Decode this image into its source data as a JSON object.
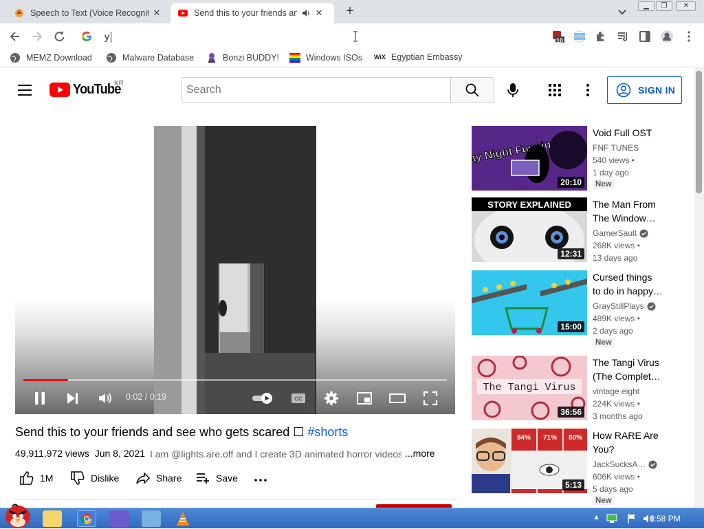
{
  "browser": {
    "tabs": [
      {
        "title": "Speech to Text (Voice Recognition)"
      },
      {
        "title": "Send this to your friends and see who gets scared"
      }
    ],
    "omnibox_text": "y",
    "extensions_badge": "10",
    "bookmarks": [
      "MEMZ Download",
      "Malware Database",
      "Bonzi BUDDY!",
      "Windows ISOs",
      "Egyptian Embassy"
    ]
  },
  "youtube": {
    "logo_text": "YouTube",
    "region": "KR",
    "search_placeholder": "Search",
    "signin_label": "SIGN IN"
  },
  "player": {
    "time": "0:02 / 0:19",
    "progress_fraction": 0.105
  },
  "video": {
    "title": "Send this to your friends and see who gets scared ☐",
    "hashtag": "#shorts",
    "views": "49,911,972 views",
    "date": "Jun 8, 2021",
    "description": "I am @lights.are.off and I create 3D animated horror videos",
    "more_label": "...more",
    "actions": {
      "likes": "1M",
      "dislike": "Dislike",
      "share": "Share",
      "save": "Save"
    }
  },
  "sidebar": [
    {
      "title_1": "Void Full OST",
      "title_2": "",
      "channel": "FNF TUNES",
      "views": "540 views •",
      "ago": "1 day ago",
      "badge": "New",
      "duration": "20:10"
    },
    {
      "title_1": "The Man From",
      "title_2": "The Window…",
      "channel": "GamerSault",
      "views": "268K views •",
      "ago": "13 days ago",
      "badge": "",
      "duration": "12:31"
    },
    {
      "title_1": "Cursed things",
      "title_2": "to do in happy…",
      "channel": "GrayStillPlays",
      "views": "489K views •",
      "ago": "2 days ago",
      "badge": "New",
      "duration": "15:00"
    },
    {
      "title_1": "The Tangi Virus",
      "title_2": "(The Complet…",
      "channel": "vintage eight",
      "views": "224K views •",
      "ago": "3 months ago",
      "badge": "",
      "duration": "36:56"
    },
    {
      "title_1": "How RARE Are",
      "title_2": "You?",
      "channel": "JackSucksA…",
      "views": "606K views •",
      "ago": "5 days ago",
      "badge": "New",
      "duration": "5:13"
    }
  ],
  "thumb_text": {
    "fnf": "Friday Night Funkin",
    "story": "STORY EXPLAINED",
    "tangi": "The Tangi Virus",
    "pcts": [
      "84%",
      "71%",
      "80%"
    ]
  },
  "taskbar": {
    "clock": "6:58 PM"
  },
  "colors": {
    "yt_red": "#ff0000",
    "link_blue": "#065fd4",
    "taskbar_blue": "#2f6ac2"
  }
}
